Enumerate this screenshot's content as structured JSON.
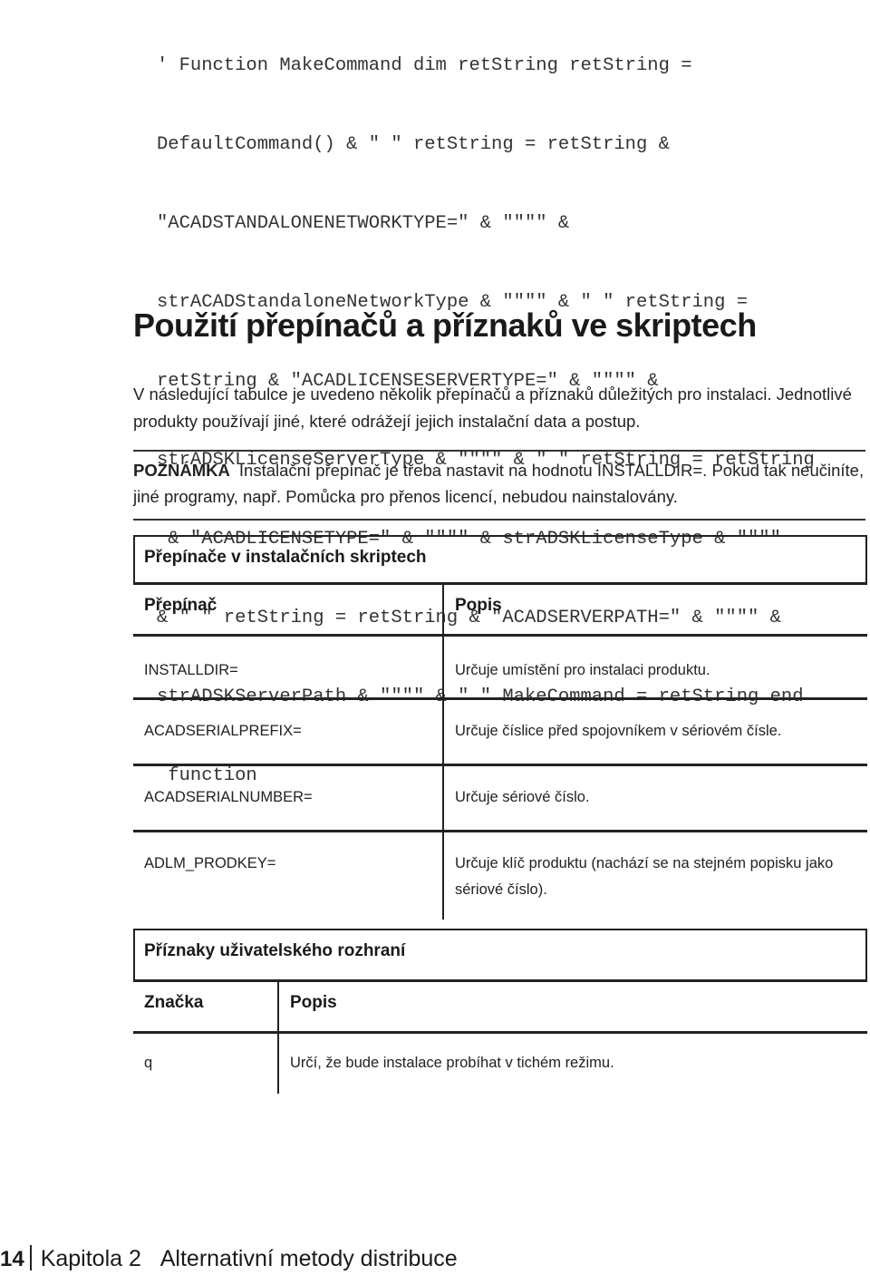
{
  "code_lines": [
    "' Function MakeCommand dim retString retString =",
    "DefaultCommand() & \" \" retString = retString &",
    "\"ACADSTANDALONENETWORKTYPE=\" & \"\"\"\" &",
    "strACADStandaloneNetworkType & \"\"\"\" & \" \" retString =",
    "retString & \"ACADLICENSESERVERTYPE=\" & \"\"\"\" &",
    "strADSKLicenseServerType & \"\"\"\" & \" \" retString = retString",
    " & \"ACADLICENSETYPE=\" & \"\"\"\" & strADSKLicenseType & \"\"\"\"",
    "& \" \" retString = retString & \"ACADSERVERPATH=\" & \"\"\"\" &",
    "strADSKServerPath & \"\"\"\" & \" \" MakeCommand = retString end",
    " function"
  ],
  "section": {
    "heading": "Použití přepínačů a příznaků ve skriptech",
    "intro": "V následující tabulce je uvedeno několik přepínačů a příznaků důležitých pro instalaci. Jednotlivé produkty používají jiné, které odrážejí jejich instalační data a postup."
  },
  "note": {
    "label": "POZNÁMKA",
    "text": "Instalační přepínač je třeba nastavit na hodnotu INSTALLDIR=. Pokud tak neučiníte, jiné programy, např. Pomůcka pro přenos licencí, nebudou nainstalovány."
  },
  "switches_table": {
    "title": "Přepínače v instalačních skriptech",
    "headers": [
      "Přepínač",
      "Popis"
    ],
    "rows": [
      [
        "INSTALLDIR=",
        "Určuje umístění pro instalaci produktu."
      ],
      [
        "ACADSERIALPREFIX=",
        "Určuje číslice před spojovníkem v sériovém čísle."
      ],
      [
        "ACADSERIALNUMBER=",
        "Určuje sériové číslo."
      ],
      [
        "ADLM_PRODKEY=",
        "Určuje klíč produktu (nachází se na stejném popisku jako sériové číslo)."
      ]
    ]
  },
  "flags_table": {
    "title": "Příznaky uživatelského rozhraní",
    "headers": [
      "Značka",
      "Popis"
    ],
    "rows": [
      [
        "q",
        "Určí, že bude instalace probíhat v tichém režimu."
      ]
    ]
  },
  "footer": {
    "page_number": "14",
    "chapter": "Kapitola 2",
    "chapter_title": "Alternativní metody distribuce"
  }
}
